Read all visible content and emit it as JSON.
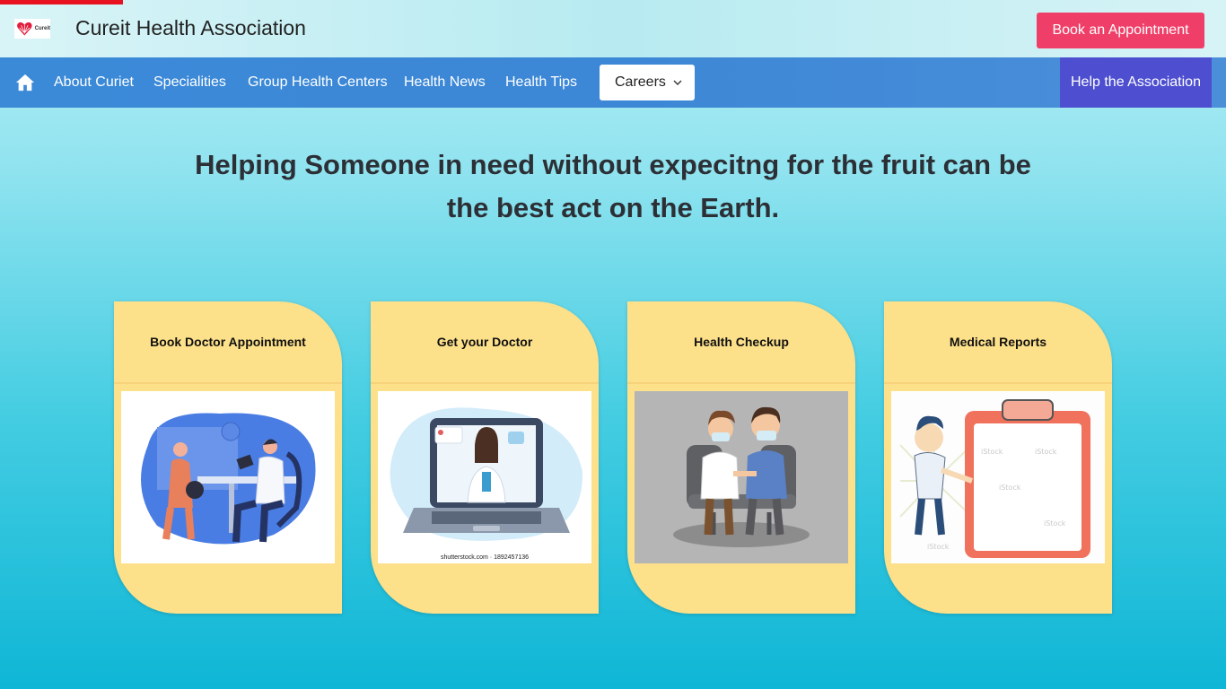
{
  "header": {
    "logo_text": "Cureit",
    "brand": "Cureit Health Association",
    "book_button": "Book an Appointment"
  },
  "nav": {
    "items": [
      {
        "label": "About Curiet"
      },
      {
        "label": "Specialities"
      },
      {
        "label": "Group Health Centers"
      },
      {
        "label": "Health News"
      },
      {
        "label": "Health Tips"
      }
    ],
    "careers": "Careers",
    "help": "Help the Association"
  },
  "hero": {
    "line1": "Helping Someone in need without expecitng for the fruit can be",
    "line2": "the best act on the Earth."
  },
  "cards": [
    {
      "title": "Book Doctor Appointment",
      "image": "doctor-consultation-illustration"
    },
    {
      "title": "Get your Doctor",
      "image": "online-doctor-laptop-illustration",
      "caption": "shutterstock.com · 1892457136"
    },
    {
      "title": "Health Checkup",
      "image": "doctor-patient-masks-illustration"
    },
    {
      "title": "Medical Reports",
      "image": "clipboard-report-illustration"
    }
  ],
  "colors": {
    "accent_pink": "#ef3f68",
    "nav_blue": "#3b8ad8",
    "help_purple": "#4d4fd0",
    "card_yellow": "#fde08a"
  }
}
